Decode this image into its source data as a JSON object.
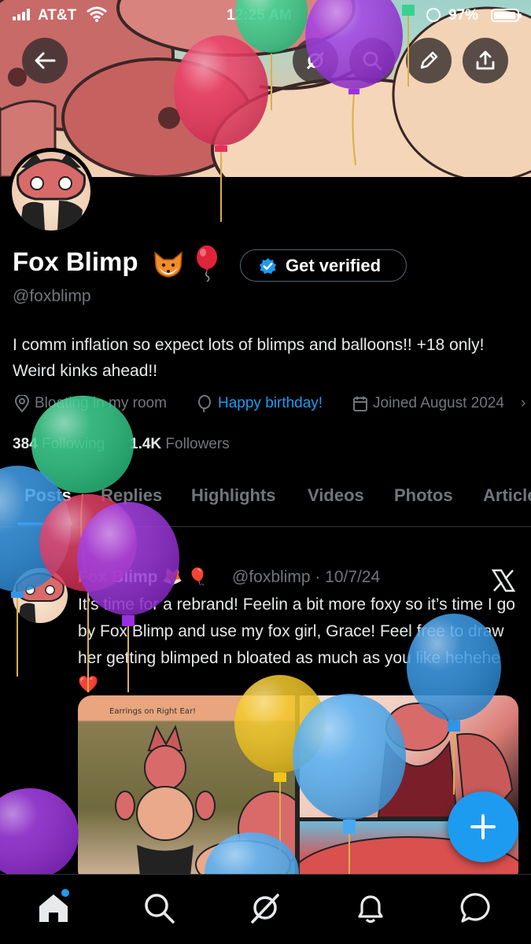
{
  "status_bar": {
    "carrier": "AT&T",
    "time": "12:25 AM",
    "battery": "97%",
    "battery_level": 0.97
  },
  "header_buttons": [
    "back-arrow-icon",
    "grok-icon",
    "search-icon",
    "edit-pencil-icon",
    "share-icon"
  ],
  "profile": {
    "name": "Fox Blimp",
    "name_emojis": [
      "fox-emoji",
      "balloon-emoji"
    ],
    "verify_label": "Get verified",
    "handle": "@foxblimp",
    "bio": "I comm inflation so expect lots of blimps and balloons!! +18 only! Weird kinks ahead!!",
    "location": "Bloating in my room",
    "birthday": "Happy birthday!",
    "joined": "Joined August 2024",
    "following_count": "384",
    "following_label": "Following",
    "followers_count": "1.4K",
    "followers_label": "Followers"
  },
  "tabs": [
    "Posts",
    "Replies",
    "Highlights",
    "Videos",
    "Photos",
    "Articles"
  ],
  "post": {
    "author": "Fox Blimp",
    "author_emojis": "🦊 🎈",
    "handle_date": "@foxblimp · 10/7/24",
    "text": "It’s time for a rebrand! Feelin a bit more foxy so it’s time I go by Fox Blimp and use my fox girl, Grace! Feel free to draw her getting blimped n bloated as much as you like hehehe ❤️",
    "image_caption": "Earrings on Right Ear!"
  },
  "colors": {
    "accent": "#1d9bf0",
    "background": "#000000",
    "muted_text": "#71767b",
    "balloons": [
      "#e8305a",
      "#2fd08a",
      "#9b2fe0",
      "#2f95e8",
      "#f2c419",
      "#4aa8f0"
    ]
  },
  "nav": [
    "home-icon",
    "search-icon",
    "grok-icon",
    "notifications-icon",
    "messages-icon"
  ]
}
